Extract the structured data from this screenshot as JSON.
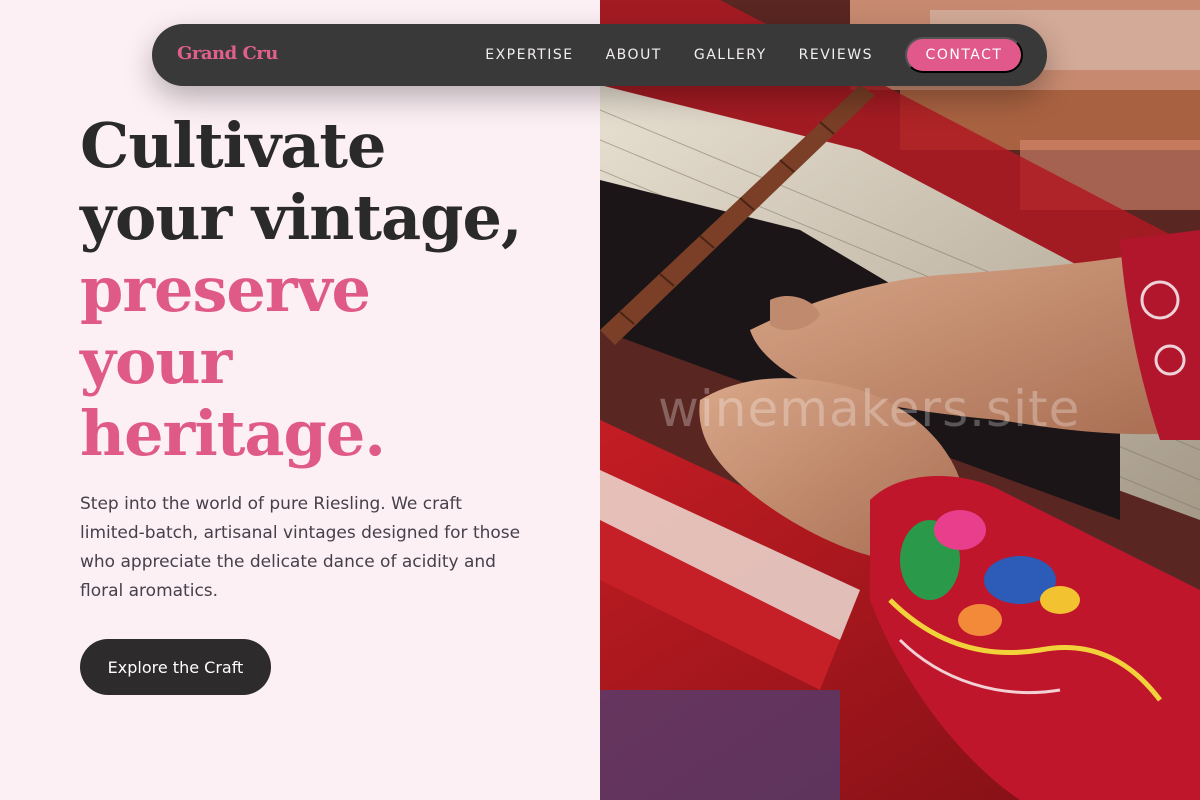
{
  "brand": {
    "name": "Grand Cru",
    "color": "#e0608a"
  },
  "nav": {
    "links": [
      "EXPERTISE",
      "ABOUT",
      "GALLERY",
      "REVIEWS"
    ],
    "contact_label": "CONTACT"
  },
  "hero": {
    "headline_lines": [
      "Cultivate",
      "your vintage,"
    ],
    "headline_accent_lines": [
      "preserve",
      "your",
      "heritage."
    ],
    "lead": "Step into the world of pure Riesling. We craft limited-batch, artisanal vintages designed for those who appreciate the delicate dance of acidity and floral aromatics.",
    "cta_label": "Explore the Craft"
  },
  "image": {
    "subject": "hands weaving colorful textile on a loom",
    "watermark": "winemakers.site"
  },
  "colors": {
    "background": "#fdf0f5",
    "accent": "#df5a87",
    "dark": "#2d2b2c",
    "navbar": "#3a3939"
  }
}
